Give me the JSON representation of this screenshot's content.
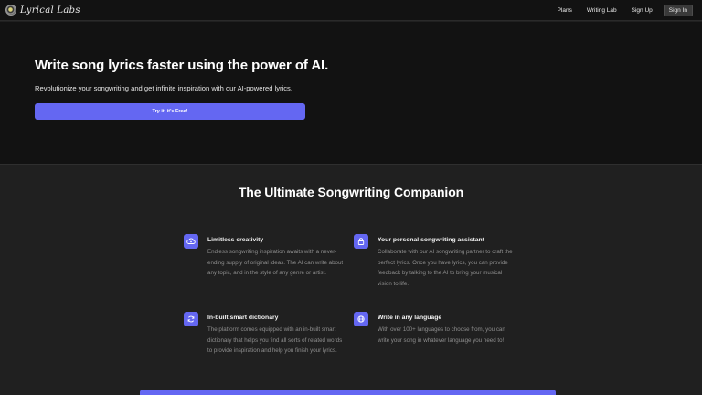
{
  "nav": {
    "logo_text": "Lyrical Labs",
    "links": [
      "Plans",
      "Writing Lab",
      "Sign Up"
    ],
    "signin_label": "Sign In"
  },
  "hero": {
    "title": "Write song lyrics faster using the power of AI.",
    "subtitle": "Revolutionize your songwriting and get infinite inspiration with our AI-powered lyrics.",
    "cta_label": "Try it, it's Free!"
  },
  "features": {
    "title": "The Ultimate Songwriting Companion",
    "items": [
      {
        "icon": "sparkle-cloud-icon",
        "title": "Limitless creativity",
        "desc": "Endless songwriting inspiration awaits with a never-ending supply of original ideas. The AI can write about any topic, and in the style of any genre or artist."
      },
      {
        "icon": "lock-icon",
        "title": "Your personal songwriting assistant",
        "desc": "Collaborate with our AI songwriting partner to craft the perfect lyrics. Once you have lyrics, you can provide feedback by talking to the AI to bring your musical vision to life."
      },
      {
        "icon": "refresh-icon",
        "title": "In-built smart dictionary",
        "desc": "The platform comes equipped with an in-built smart dictionary that helps you find all sorts of related words to provide inspiration and help you finish your lyrics."
      },
      {
        "icon": "globe-icon",
        "title": "Write in any language",
        "desc": "With over 100+ languages to choose from, you can write your song in whatever language you need to!"
      }
    ]
  },
  "colors": {
    "accent": "#6467f2",
    "hero_bg": "#121212",
    "section_bg": "#202020"
  }
}
